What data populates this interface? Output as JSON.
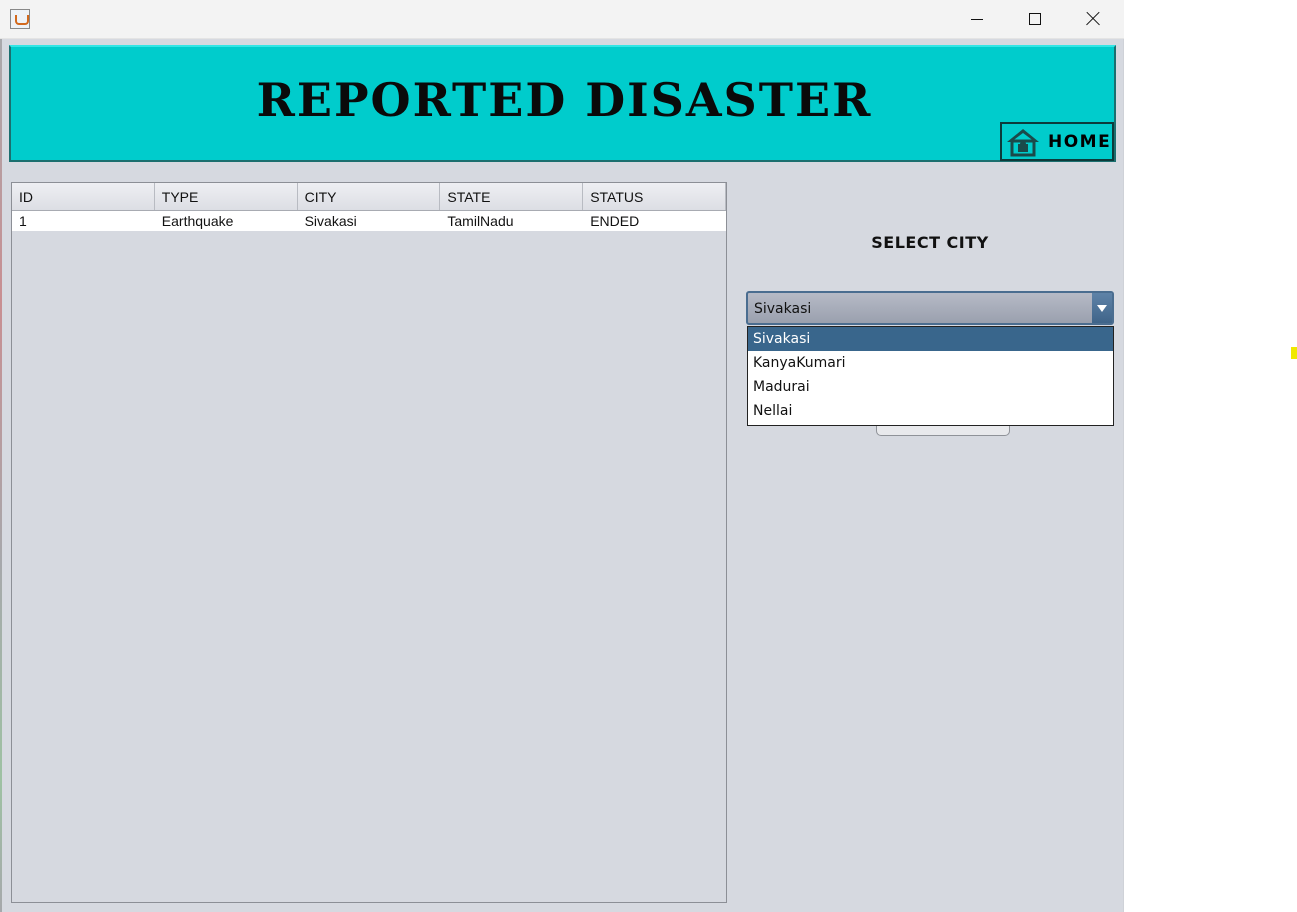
{
  "window": {
    "controls": {
      "minimize": "minimize-icon",
      "maximize": "maximize-icon",
      "close": "close-icon"
    }
  },
  "banner": {
    "title": "REPORTED DISASTER",
    "home_label": "HOME",
    "background": "#00cccc"
  },
  "table": {
    "columns": [
      "ID",
      "TYPE",
      "CITY",
      "STATE",
      "STATUS"
    ],
    "rows": [
      [
        "1",
        "Earthquake",
        "Sivakasi",
        "TamilNadu",
        "ENDED"
      ]
    ]
  },
  "city_select": {
    "label": "SELECT CITY",
    "selected": "Sivakasi",
    "options": [
      "Sivakasi",
      "KanyaKumari",
      "Madurai",
      "Nellai"
    ]
  },
  "colors": {
    "selection": "#39668c",
    "panel": "#d6d9e0"
  }
}
